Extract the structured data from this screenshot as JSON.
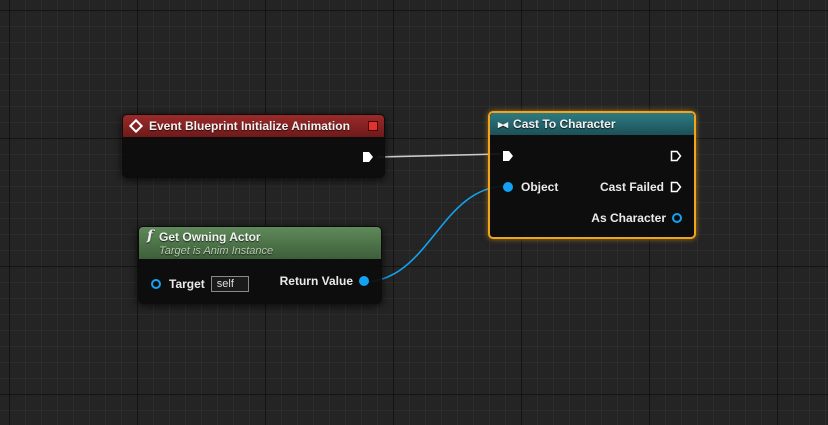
{
  "colors": {
    "exec_wire": "#cccccc",
    "object_wire": "#13a2f2",
    "event_header": "#8a2424",
    "cast_header": "#26666d",
    "func_header": "#527a4e",
    "selection_outline": "#f0a51c"
  },
  "event_node": {
    "title": "Event Blueprint Initialize Animation",
    "icon": "event-diamond-icon"
  },
  "cast_node": {
    "title": "Cast To Character",
    "icon": "cast-arrow-icon",
    "pins": {
      "object_label": "Object",
      "cast_failed_label": "Cast Failed",
      "as_character_label": "As Character"
    }
  },
  "func_node": {
    "title": "Get Owning Actor",
    "subtitle": "Target is Anim Instance",
    "icon": "function-icon",
    "pins": {
      "target_label": "Target",
      "target_default": "self",
      "return_label": "Return Value"
    }
  }
}
